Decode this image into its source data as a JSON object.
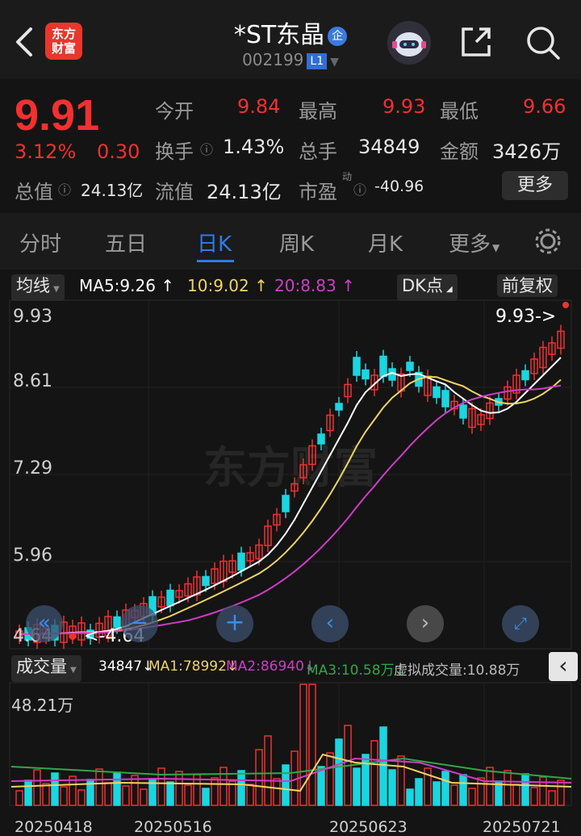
{
  "header": {
    "title": "*ST东晶",
    "badge": "企",
    "code": "002199",
    "level": "L1",
    "logo": "东方财富"
  },
  "quote": {
    "price": "9.91",
    "change_pct": "3.12%",
    "change": "0.30",
    "open_label": "今开",
    "open": "9.84",
    "high_label": "最高",
    "high": "9.93",
    "low_label": "最低",
    "low": "9.66",
    "turnover_label": "换手",
    "turnover": "1.43%",
    "volume_label": "总手",
    "volume": "34849",
    "amount_label": "金额",
    "amount": "3426万",
    "mktcap_label": "总值",
    "mktcap": "24.13亿",
    "float_label": "流值",
    "float": "24.13亿",
    "pe_label": "市盈",
    "pe_sup": "动",
    "pe": "-40.96",
    "more": "更多"
  },
  "tabs": [
    "分时",
    "五日",
    "日K",
    "周K",
    "月K",
    "更多"
  ],
  "active_tab": "日K",
  "kline": {
    "ma_selector": "均线",
    "ma5": "MA5:9.26",
    "ma10": "10:9.02",
    "ma20": "20:8.83",
    "dk": "DK点",
    "adjust": "前复权",
    "y_labels": [
      "9.93",
      "8.61",
      "7.29",
      "5.96",
      "4.64"
    ],
    "high_marker": "9.93->",
    "low_marker": "<-4.64",
    "watermark": "东方财富"
  },
  "volume": {
    "selector": "成交量",
    "value": "34847",
    "ma1": "MA1:78992",
    "ma2": "MA2:86940",
    "ma3": "MA3:10.58万",
    "virtual": "虚拟成交量:10.88万",
    "y_label": "48.21万",
    "dates": [
      "20250418",
      "20250516",
      "20250623",
      "20250721"
    ]
  },
  "colors": {
    "up": "#f23030",
    "down": "#19d6e0",
    "ma5": "#ffffff",
    "ma10": "#f0d460",
    "ma20": "#d03cc8",
    "vma3": "#2ea84a",
    "accent": "#2f7be8"
  }
}
